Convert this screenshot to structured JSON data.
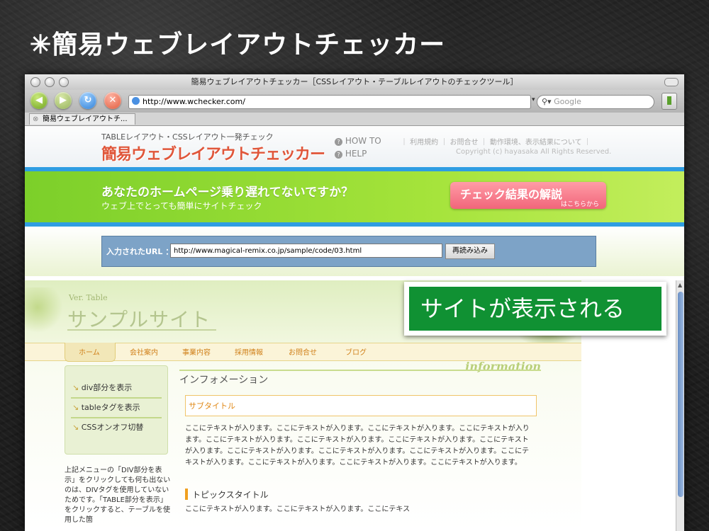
{
  "slide_title": "✳簡易ウェブレイアウトチェッカー",
  "window": {
    "title": "簡易ウェブレイアウトチェッカー［CSSレイアウト・テーブルレイアウトのチェックツール］",
    "url": "http://www.wchecker.com/",
    "search_placeholder": "Google",
    "tab_label": "簡易ウェブレイアウトチ..."
  },
  "site": {
    "tagline": "TABLEレイアウト・CSSレイアウト一発チェック",
    "logo": "簡易ウェブレイアウトチェッカー",
    "howto": "HOW TO",
    "help": "HELP",
    "nav": "｜ 利用規約 ｜ お問合せ ｜ 動作環境、表示結果について ｜",
    "copyright": "Copyright (c) hayasaka All Rights Reserved.",
    "banner_line1": "あなたのホームページ乗り遅れてないですか？",
    "banner_line2": "ウェブ上でとっても簡単にサイトチェック",
    "banner_button": "チェック結果の解説",
    "banner_button_sub": "はこちらから",
    "url_label": "入力されたURL ：",
    "url_value": "http://www.magical-remix.co.jp/sample/code/03.html",
    "reload_button": "再読み込み"
  },
  "sample": {
    "ver": "Ver. Table",
    "title": "サンプルサイト",
    "menu": [
      "ホーム",
      "会社案内",
      "事業内容",
      "採用情報",
      "お問合せ",
      "ブログ"
    ],
    "side_items": [
      "div部分を表示",
      "tableタグを表示",
      "CSSオンオフ切替"
    ],
    "side_note": "上記メニューの「DIV部分を表示」をクリックしても何も出ないのは、DIVタグを使用していないためです。「TABLE部分を表示」をクリックすると、テーブルを使用した箇",
    "info_tag": "information",
    "info_heading": "インフォメーション",
    "subtitle": "サブタイトル",
    "body_text": "ここにテキストが入ります。ここにテキストが入ります。ここにテキストが入ります。ここにテキストが入ります。ここにテキストが入ります。ここにテキストが入ります。ここにテキストが入ります。ここにテキストが入ります。ここにテキストが入ります。ここにテキストが入ります。ここにテキストが入ります。ここにテキストが入ります。ここにテキストが入ります。ここにテキストが入ります。ここにテキストが入ります。",
    "topic_title": "トピックスタイトル",
    "topic_text": "ここにテキストが入ります。ここにテキストが入ります。ここにテキス"
  },
  "callout": "サイトが表示される"
}
